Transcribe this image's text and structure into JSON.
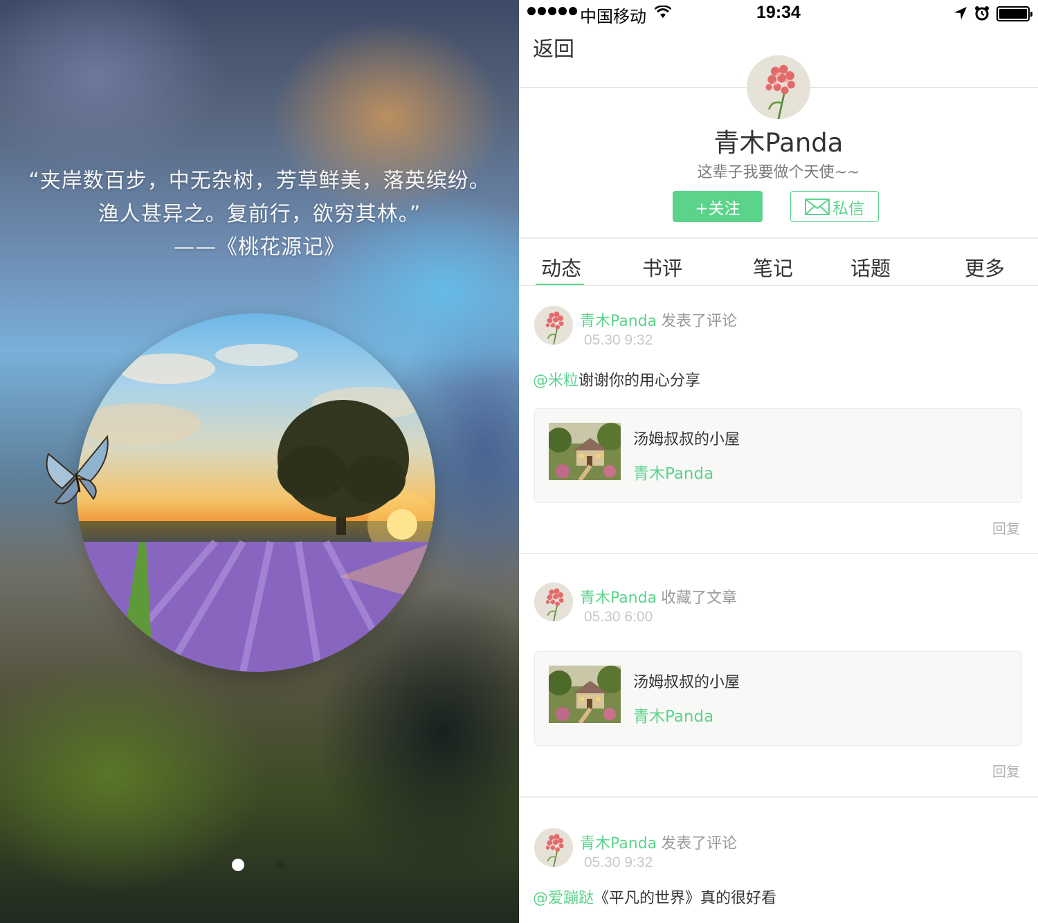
{
  "left": {
    "quote_lines": [
      "“夹岸数百步，中无杂树，芳草鲜美，落英缤纷。",
      "渔人甚异之。复前行，欲穷其林。”",
      "——《桃花源记》"
    ],
    "page_indicator": {
      "current": 1,
      "total": 2
    }
  },
  "status_bar": {
    "carrier": "中国移动",
    "time": "19:34"
  },
  "nav": {
    "back_label": "返回"
  },
  "profile": {
    "name": "青木Panda",
    "bio": "这辈子我要做个天使~~",
    "follow_label": "+关注",
    "message_label": "私信"
  },
  "tabs": [
    {
      "label": "动态",
      "active": true
    },
    {
      "label": "书评",
      "active": false
    },
    {
      "label": "笔记",
      "active": false
    },
    {
      "label": "话题",
      "active": false
    },
    {
      "label": "更多",
      "active": false
    }
  ],
  "feed": [
    {
      "user": "青木Panda",
      "action": "发表了评论",
      "time": "05.30 9:32",
      "mention": "@米粒",
      "text": "谢谢你的用心分享",
      "card": {
        "title": "汤姆叔叔的小屋",
        "author": "青木Panda"
      },
      "reply_label": "回复"
    },
    {
      "user": "青木Panda",
      "action": "收藏了文章",
      "time": "05.30 6:00",
      "card": {
        "title": "汤姆叔叔的小屋",
        "author": "青木Panda"
      },
      "reply_label": "回复"
    },
    {
      "user": "青木Panda",
      "action": "发表了评论",
      "time": "05.30 9:32",
      "mention": "@爱蹦跶",
      "text": "《平凡的世界》真的很好看"
    }
  ],
  "colors": {
    "accent": "#5bd38b",
    "text_primary": "#333333",
    "text_muted": "#9a9a9a"
  }
}
